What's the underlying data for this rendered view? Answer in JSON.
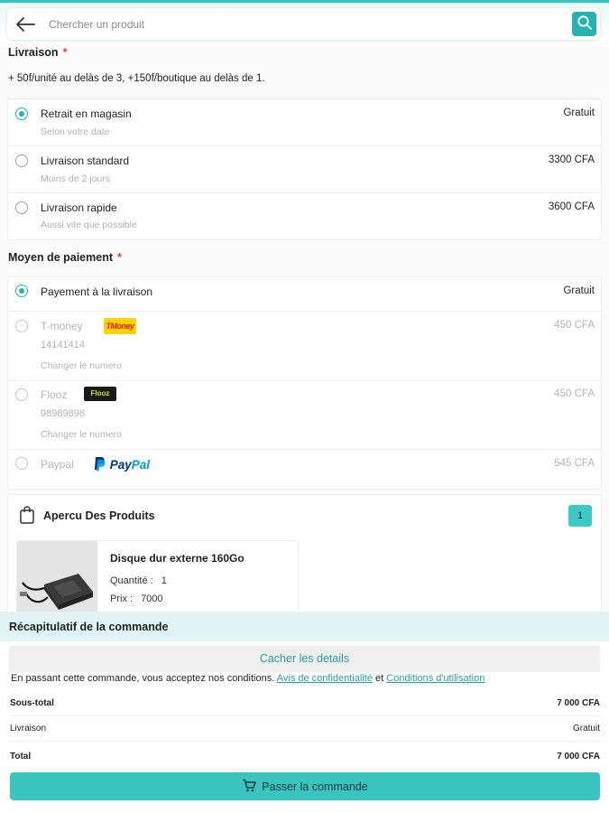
{
  "search": {
    "placeholder": "Chercher un produit"
  },
  "livraison": {
    "title": "Livraison",
    "required_mark": "*",
    "note": "+ 50f/unité au delàs de 3, +150f/boutique au delàs de 1.",
    "options": [
      {
        "label": "Retrait en magasin",
        "sub": "Selon votre date",
        "price": "Gratuit",
        "selected": true
      },
      {
        "label": "Livraison standard",
        "sub": "Moins de 2 jours",
        "price": "3300 CFA",
        "selected": false
      },
      {
        "label": "Livraison rapide",
        "sub": "Aussi vite que possible",
        "price": "3600 CFA",
        "selected": false
      }
    ]
  },
  "paiement": {
    "title": "Moyen de paiement",
    "required_mark": "*",
    "options": [
      {
        "label": "Payement à la livraison",
        "price": "Gratuit",
        "selected": true
      },
      {
        "label": "T-money",
        "logo_text": "TMoney",
        "number": "14141414",
        "change": "Changer le numero",
        "price": "450 CFA",
        "selected": false
      },
      {
        "label": "Flooz",
        "logo_text": "Flooz",
        "number": "98989896",
        "change": "Changer le numero",
        "price": "450 CFA",
        "selected": false
      },
      {
        "label": "Paypal",
        "logo_text_1": "Pay",
        "logo_text_2": "Pal",
        "price": "545 CFA",
        "selected": false
      }
    ]
  },
  "products": {
    "title": "Apercu Des Produits",
    "count": "1",
    "items": [
      {
        "name": "Disque dur externe 160Go",
        "qty_label": "Quantité :",
        "qty": "1",
        "price_label": "Prix :",
        "price": "7000"
      }
    ]
  },
  "summary": {
    "title": "Récapitulatif de la commande",
    "hide_details": "Cacher les details",
    "terms_text": "En passant cette commande, vous acceptez nos conditions.",
    "privacy_link": "Avis de confidentialité",
    "and": "et",
    "terms_link": "Conditions d'utilisation",
    "rows": [
      {
        "label": "Sous-total",
        "value": "7 000 CFA"
      },
      {
        "label": "Livraison",
        "value": "Gratuit"
      },
      {
        "label": "Total",
        "value": "7 000 CFA"
      }
    ],
    "order_button": "Passer la commande"
  },
  "colors": {
    "accent": "#39c5bf",
    "accent_dark": "#27b3ad",
    "required": "#e53935"
  }
}
